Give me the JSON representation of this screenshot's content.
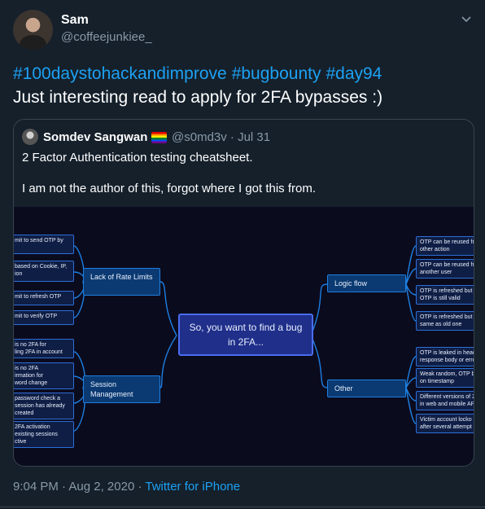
{
  "tweet": {
    "author_name": "Sam",
    "author_handle": "@coffeejunkiee_",
    "hashtags": [
      "#100daystohackandimprove",
      "#bugbounty",
      "#day94"
    ],
    "text": "Just interesting read to apply for 2FA bypasses :)",
    "time": "9:04 PM",
    "separator": "·",
    "date": "Aug 2, 2020",
    "source": "Twitter for iPhone"
  },
  "quote": {
    "author_name": "Somdev Sangwan",
    "author_handle": "@s0md3v",
    "separator": "·",
    "date": "Jul 31",
    "line1": "2 Factor Authentication testing cheatsheet.",
    "line2": "I am not the author of this, forgot where I got this from."
  },
  "mindmap": {
    "center": "So, you want to find a bug in 2FA...",
    "left_top": {
      "title": "Lack of Rate Limits",
      "leaves": [
        "mit to send OTP by",
        "based on Cookie, IP,",
        "mit to refresh OTP",
        "mit to verify OTP"
      ],
      "leaf_extra": [
        "",
        "ion",
        "",
        ""
      ]
    },
    "left_bottom": {
      "title": "Session Management",
      "leaves": [
        "is no 2FA for",
        "is no 2FA",
        "password check a",
        "2FA activation"
      ],
      "leaf_extra": [
        "ling 2FA in account",
        "irmation for",
        "session has already",
        "existing sessions"
      ],
      "leaf_extra2": [
        "",
        "word change",
        "created",
        "ctive"
      ]
    },
    "right_top": {
      "title": "Logic flow",
      "leaves": [
        "OTP can be reused fr",
        "OTP can be reused fr",
        "OTP is refreshed but",
        "OTP is refreshed but i"
      ],
      "leaf_extra": [
        "other action",
        "another user",
        "OTP is still valid",
        "same as old one"
      ]
    },
    "right_bottom": {
      "title": "Other",
      "leaves": [
        "OTP is leaked in head",
        "Weak random, OTP ba",
        "Different versions of 2",
        "Victim account locko"
      ],
      "leaf_extra": [
        "response body or erro",
        "on timestamp",
        "in web and mobile AP",
        "after several attempt"
      ]
    }
  },
  "colors": {
    "background": "#15202b",
    "accent": "#1da1f2",
    "muted": "#8899a6",
    "border": "#38444d",
    "mindmap_line": "#1d7fe0"
  }
}
